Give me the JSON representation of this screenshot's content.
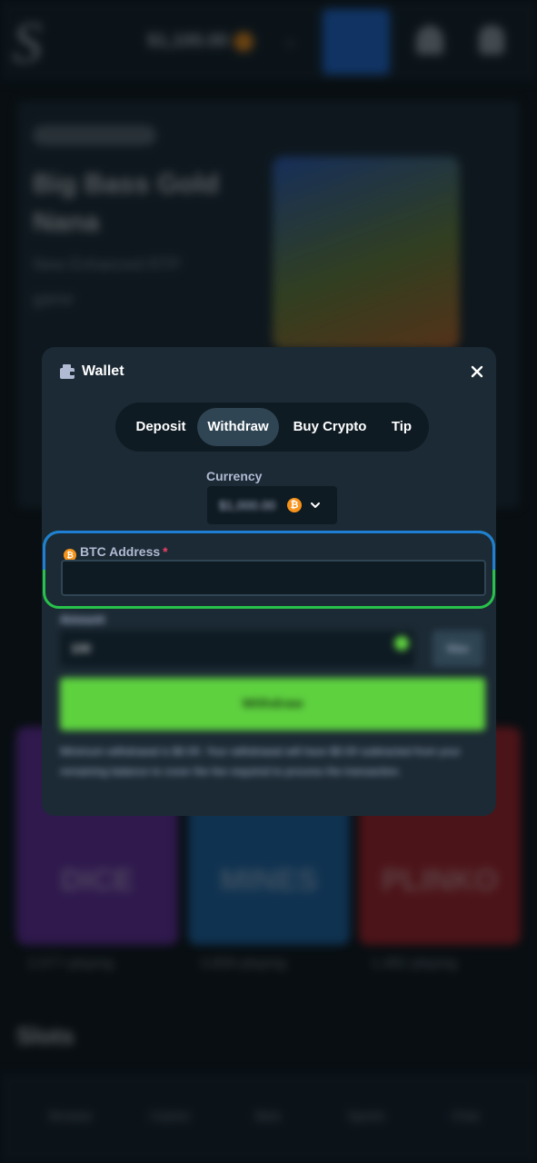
{
  "background": {
    "logo": "S",
    "balance": "$1,100.00",
    "promo": {
      "title": "Big Bass Gold Nana",
      "subtitle": "New Enhanced RTP game"
    },
    "games": [
      {
        "label": "DICE",
        "playing": "2,577 playing",
        "color": "#6b2fa8"
      },
      {
        "label": "MINES",
        "playing": "3,809 playing",
        "color": "#1e6bb0"
      },
      {
        "label": "PLINKO",
        "playing": "1,482 playing",
        "color": "#b0222a"
      }
    ],
    "slots_heading": "Slots",
    "nav": [
      "Browse",
      "Casino",
      "Bets",
      "Sports",
      "Chat"
    ]
  },
  "modal": {
    "title": "Wallet",
    "tabs": [
      {
        "label": "Deposit",
        "active": false
      },
      {
        "label": "Withdraw",
        "active": true
      },
      {
        "label": "Buy Crypto",
        "active": false
      },
      {
        "label": "Tip",
        "active": false
      }
    ],
    "currency": {
      "label": "Currency",
      "value": "$1,000.00",
      "coin_symbol": "₿"
    },
    "address": {
      "label": "BTC Address",
      "required_mark": "*",
      "value": "",
      "placeholder": ""
    },
    "amount": {
      "label": "Amount",
      "value": "100",
      "max_label": "Max"
    },
    "withdraw_button": "Withdraw",
    "note": "Minimum withdrawal is $0.00. Your withdrawal will have $0.00 subtracted from your remaining balance to cover the fee required to process the transaction."
  },
  "colors": {
    "highlight_outer": "#28c24a",
    "highlight_top": "#1f7fd4",
    "withdraw_green": "#5ed13f",
    "btc_orange": "#f7931a"
  }
}
